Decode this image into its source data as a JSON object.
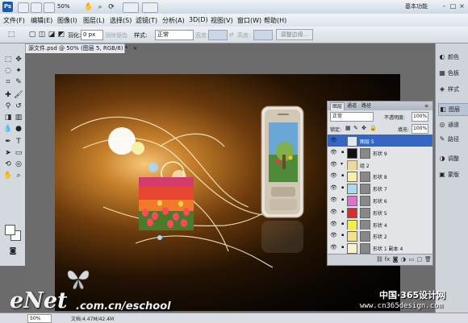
{
  "appbar": {
    "logo": "Ps",
    "zoom": "50%",
    "workspace": "基本功能",
    "window_controls": [
      "–",
      "□",
      "×"
    ]
  },
  "menu": [
    "文件(F)",
    "编辑(E)",
    "图像(I)",
    "图层(L)",
    "选择(S)",
    "滤镜(T)",
    "分析(A)",
    "3D(D)",
    "视图(V)",
    "窗口(W)",
    "帮助(H)"
  ],
  "options": {
    "feather_label": "羽化:",
    "feather_value": "0 px",
    "antialias_label": "消除锯齿",
    "style_label": "样式:",
    "style_value": "正常",
    "width_label": "宽度:",
    "height_label": "高度:",
    "refine_edge": "调整边缘..."
  },
  "document": {
    "tab_title": "源文件.psd @ 50% (图层 5, RGB/8) *",
    "close_glyph": "×"
  },
  "status": {
    "zoom": "50%",
    "doc_info": "文档:4.47M/42.4M"
  },
  "layers_panel": {
    "tabs": [
      "图层",
      "通道",
      "路径"
    ],
    "blend_mode": "正常",
    "opacity_label": "不透明度:",
    "opacity_value": "100%",
    "lock_label": "锁定:",
    "fill_label": "填充:",
    "fill_value": "100%",
    "layers": [
      {
        "name": "图层 5",
        "selected": true,
        "thumb": "#dfe8f4",
        "mask": false
      },
      {
        "name": "形状 9",
        "selected": false,
        "thumb": "#111111",
        "mask": true
      },
      {
        "name": "组 2",
        "selected": false,
        "thumb": "folder",
        "mask": false
      },
      {
        "name": "形状 8",
        "selected": false,
        "thumb": "#f6f0a8",
        "mask": true
      },
      {
        "name": "形状 7",
        "selected": false,
        "thumb": "#a9d8f3",
        "mask": true
      },
      {
        "name": "形状 6",
        "selected": false,
        "thumb": "#e070d0",
        "mask": true
      },
      {
        "name": "形状 5",
        "selected": false,
        "thumb": "#e02a2a",
        "mask": true
      },
      {
        "name": "形状 4",
        "selected": false,
        "thumb": "#f4ee40",
        "mask": true
      },
      {
        "name": "形状 2",
        "selected": false,
        "thumb": "#f2e28a",
        "mask": true
      },
      {
        "name": "形状 1 副本 4",
        "selected": false,
        "thumb": "#f7f3c9",
        "mask": true
      }
    ]
  },
  "dock": [
    {
      "icon": "palette-icon",
      "glyph": "◐",
      "label": "颜色"
    },
    {
      "icon": "swatches-icon",
      "glyph": "▦",
      "label": "色板"
    },
    {
      "icon": "styles-icon",
      "glyph": "◈",
      "label": "样式"
    },
    {
      "icon": "layers-icon",
      "glyph": "◧",
      "label": "图层"
    },
    {
      "icon": "channels-icon",
      "glyph": "◎",
      "label": "通道"
    },
    {
      "icon": "paths-icon",
      "glyph": "✎",
      "label": "路径"
    },
    {
      "icon": "adjustments-icon",
      "glyph": "◑",
      "label": "调整"
    },
    {
      "icon": "masks-icon",
      "glyph": "▣",
      "label": "蒙版"
    }
  ],
  "watermark": {
    "brand": "eNet",
    "site": ".com.cn/eschool",
    "cn": "中国·365设计网",
    "url": "www.cn365design.com"
  },
  "colors": {
    "selection_blue": "#3467c4",
    "canvas_glow": "#c9822c"
  }
}
